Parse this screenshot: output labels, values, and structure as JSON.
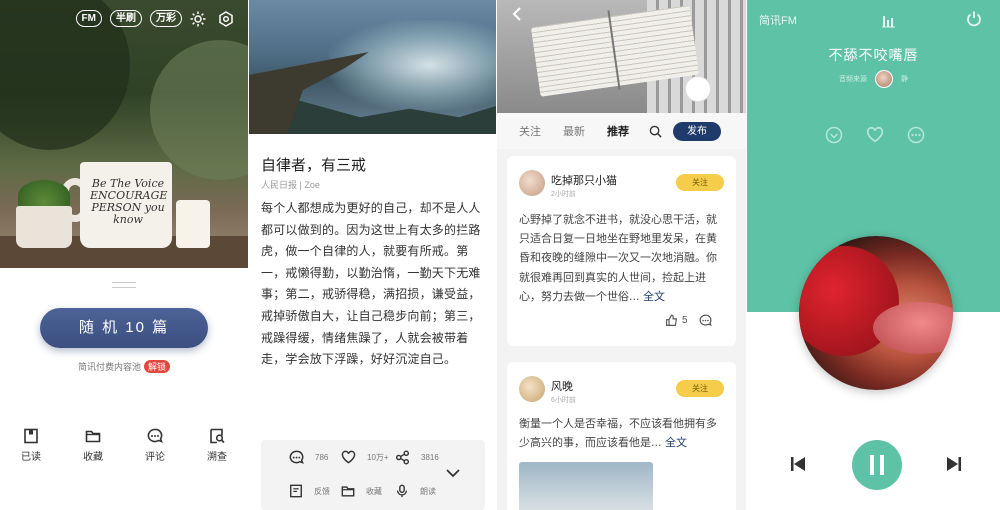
{
  "panel1": {
    "top_badges": [
      "FM",
      "半刷",
      "万彩"
    ],
    "random_button": "随 机 10 篇",
    "pool_text": "简讯付费内容池",
    "unlock_badge": "解锁",
    "mug_text": "Be The Voice ENCOURAGE PERSON you know",
    "tabs": [
      {
        "label": "已读",
        "icon": "read-icon"
      },
      {
        "label": "收藏",
        "icon": "folder-icon"
      },
      {
        "label": "评论",
        "icon": "comment-icon"
      },
      {
        "label": "溯查",
        "icon": "search-doc-icon"
      }
    ]
  },
  "panel2": {
    "title": "自律者，有三戒",
    "source": "人民日报 | Zoe",
    "body": "每个人都想成为更好的自己，却不是人人都可以做到的。因为这世上有太多的拦路虎，做一个自律的人，就要有所戒。第一，戒懒得勤，以勤治惰，一勤天下无难事；第二，戒骄得稳，满招损，谦受益，戒掉骄傲自大，让自己稳步向前；第三，戒躁得缓，情绪焦躁了，人就会被带着走，学会放下浮躁，好好沉淀自己。",
    "actions": {
      "comments": "786",
      "likes": "10万+",
      "shares": "3816",
      "feedback": "反馈",
      "collect": "收藏",
      "read_aloud": "朗读"
    }
  },
  "panel3": {
    "nav": [
      "关注",
      "最新",
      "推荐"
    ],
    "active_nav": "推荐",
    "publish": "发布",
    "posts": [
      {
        "name": "吃掉那只小猫",
        "time": "2小时前",
        "follow": "关注",
        "text": "心野掉了就念不进书，就没心思干活，就只适合日复一日地坐在野地里发呆，在黄昏和夜晚的缝隙中一次又一次地消融。你就很难再回到真实的人世间，捡起上进心，努力去做一个世俗...",
        "more": "全文",
        "likes": "5"
      },
      {
        "name": "风晚",
        "time": "6小时前",
        "follow": "关注",
        "text": "衡量一个人是否幸福，不应该看他拥有多少高兴的事，而应该看他是...",
        "more": "全文"
      }
    ]
  },
  "panel4": {
    "brand": "简讯FM",
    "song": "不舔不咬嘴唇",
    "artist_label": "音频来源",
    "artist_suffix": "静",
    "colors": {
      "accent": "#5ec3a6"
    }
  }
}
